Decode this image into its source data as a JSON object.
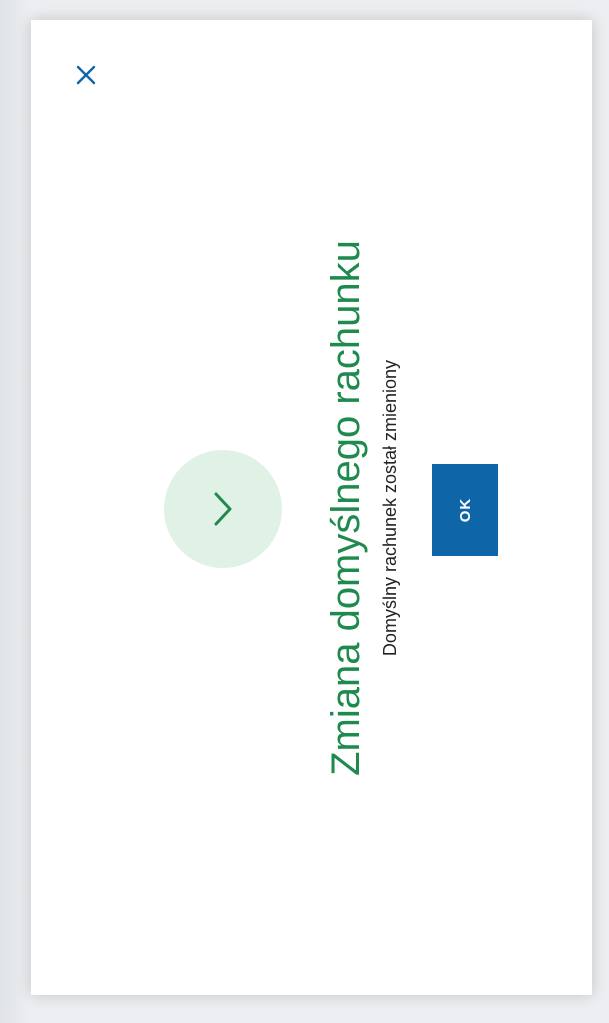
{
  "dialog": {
    "title": "Zmiana domyślnego rachunku",
    "message": "Domyślny rachunek został zmieniony",
    "ok_label": "OK"
  },
  "colors": {
    "title": "#1f8a4d",
    "ok_button": "#0e66a8",
    "success_circle": "#e0f1e6",
    "close_icon": "#0e66a8"
  },
  "icons": {
    "close": "close-icon",
    "success": "chevron-check-icon"
  }
}
